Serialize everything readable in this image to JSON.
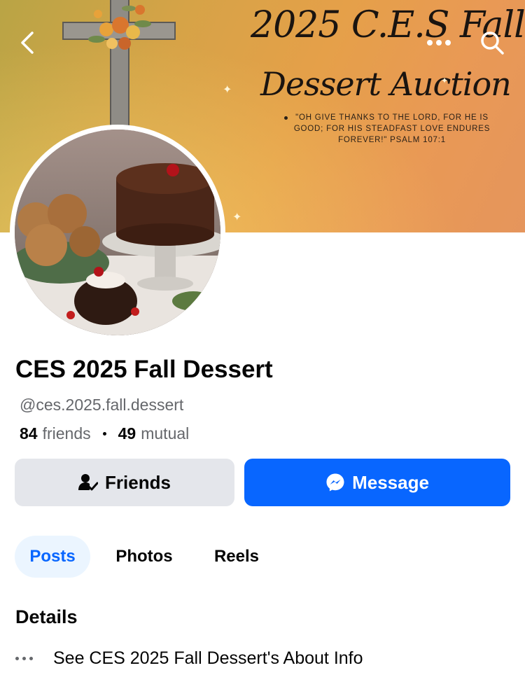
{
  "cover": {
    "title_line1": "2025 C.E.S Fall",
    "title_line2": "Dessert Auction",
    "verse": "\"OH GIVE THANKS TO THE LORD, FOR HE IS GOOD; FOR HIS STEADFAST LOVE ENDURES FOREVER!\" PSALM 107:1"
  },
  "nav": {
    "back_icon": "chevron-left-icon",
    "more_icon": "more-dots-icon",
    "search_icon": "search-icon"
  },
  "profile": {
    "name": "CES 2025 Fall Dessert",
    "username": "@ces.2025.fall.dessert",
    "friends_count": "84",
    "friends_label": "friends",
    "mutual_count": "49",
    "mutual_label": "mutual"
  },
  "actions": {
    "friends_label": "Friends",
    "message_label": "Message"
  },
  "tabs": [
    {
      "label": "Posts",
      "active": true
    },
    {
      "label": "Photos",
      "active": false
    },
    {
      "label": "Reels",
      "active": false
    }
  ],
  "details": {
    "title": "Details",
    "about_text": "See CES 2025 Fall Dessert's About Info"
  },
  "colors": {
    "accent": "#0866ff",
    "secondary_button": "#e4e6eb",
    "muted_text": "#65676b",
    "active_tab_bg": "#ebf5ff"
  }
}
